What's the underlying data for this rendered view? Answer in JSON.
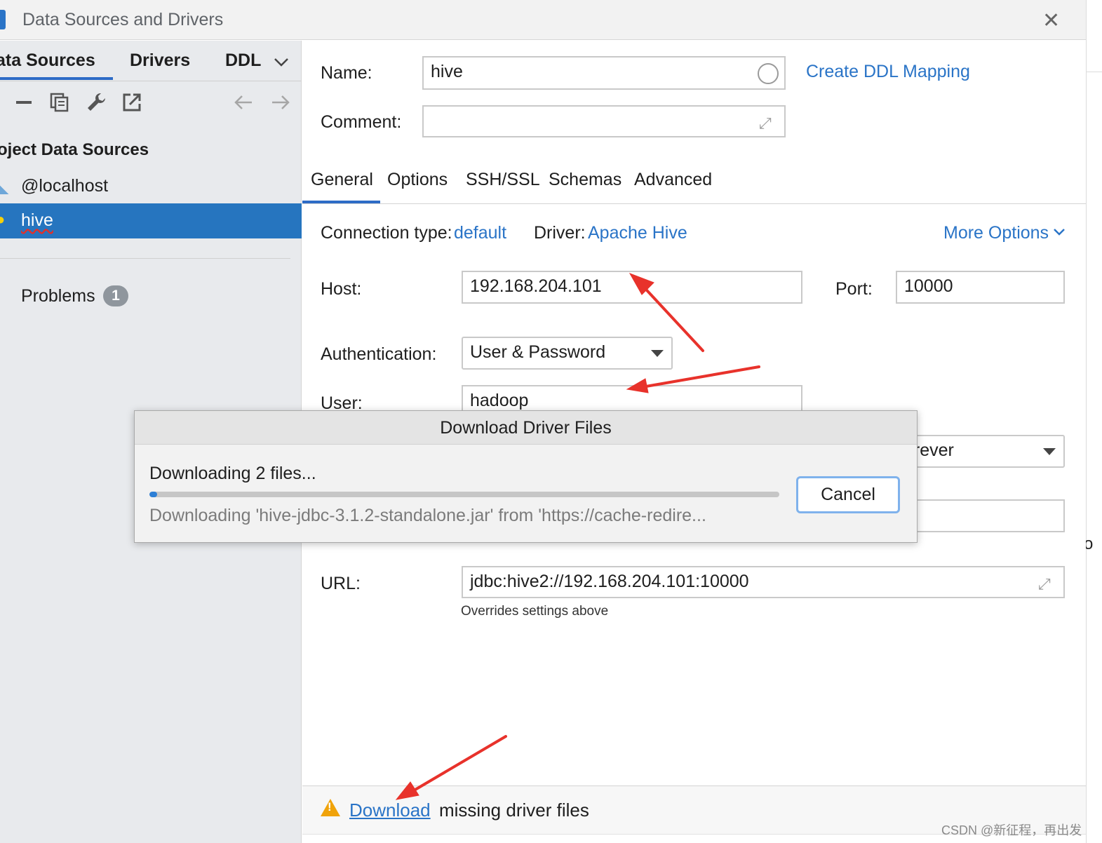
{
  "window": {
    "title": "Data Sources and Drivers"
  },
  "left_panel": {
    "tabs": [
      "ata Sources",
      "Drivers",
      "DDL"
    ],
    "section_title": "oject Data Sources",
    "items": [
      {
        "label": "@localhost"
      },
      {
        "label": "hive",
        "selected": true
      }
    ],
    "problems": {
      "label": "Problems",
      "count": "1"
    }
  },
  "form": {
    "name_label": "Name:",
    "name_value": "hive",
    "create_ddl_link": "Create DDL Mapping",
    "comment_label": "Comment:",
    "comment_value": "",
    "tabs": [
      "General",
      "Options",
      "SSH/SSL",
      "Schemas",
      "Advanced"
    ],
    "connection_type_label": "Connection type:",
    "connection_type_value": "default",
    "driver_label": "Driver:",
    "driver_value": "Apache Hive",
    "more_options": "More Options",
    "host_label": "Host:",
    "host_value": "192.168.204.101",
    "port_label": "Port:",
    "port_value": "10000",
    "auth_label": "Authentication:",
    "auth_value": "User & Password",
    "user_label": "User:",
    "user_value": "hadoop",
    "save_value_partial": "orever",
    "url_label": "URL:",
    "url_value": "jdbc:hive2://192.168.204.101:10000",
    "url_hint": "Overrides settings above"
  },
  "bottom_bar": {
    "download_link": "Download",
    "rest": "missing driver files"
  },
  "modal": {
    "title": "Download Driver Files",
    "status": "Downloading 2 files...",
    "progress": 0.01,
    "detail": "Downloading 'hive-jdbc-3.1.2-standalone.jar' from 'https://cache-redire...",
    "cancel": "Cancel"
  },
  "edge_text": "o",
  "watermark": "CSDN @新征程，再出发",
  "colors": {
    "accent": "#2675bf",
    "link": "#2a74c7",
    "annotation_arrow": "#e8322b",
    "warning": "#f0a30a"
  }
}
